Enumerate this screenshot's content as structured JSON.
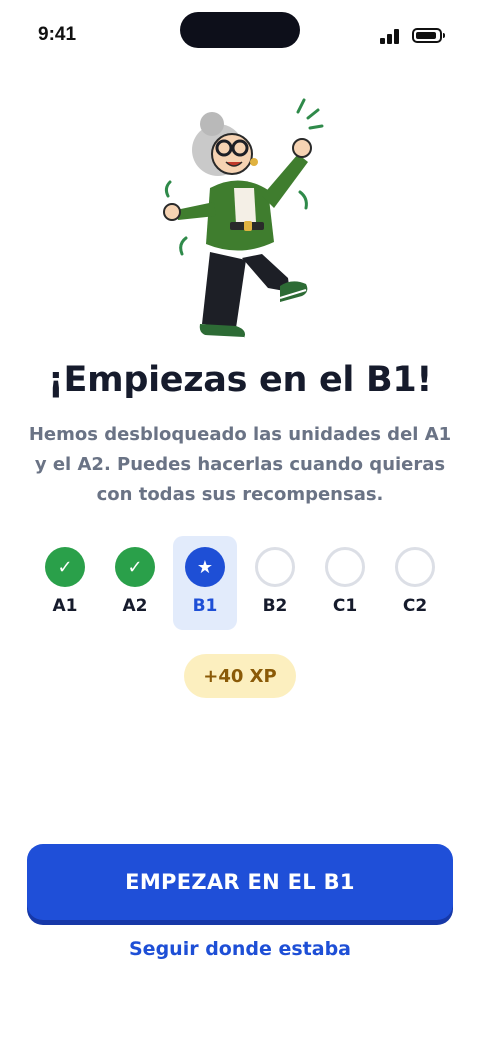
{
  "status_bar": {
    "time": "9:41"
  },
  "illustration": {
    "name": "dancing-grandma-illustration"
  },
  "title": "¡Empiezas en el B1!",
  "subtitle_lines": [
    "Hemos desbloqueado las unidades del A1",
    "y el A2. Puedes hacerlas cuando quieras",
    "con todas sus recompensas."
  ],
  "levels": [
    {
      "label": "A1",
      "state": "done",
      "glyph": "✓"
    },
    {
      "label": "A2",
      "state": "done",
      "glyph": "✓"
    },
    {
      "label": "B1",
      "state": "active",
      "glyph": "★"
    },
    {
      "label": "B2",
      "state": "locked",
      "glyph": ""
    },
    {
      "label": "C1",
      "state": "locked",
      "glyph": ""
    },
    {
      "label": "C2",
      "state": "locked",
      "glyph": ""
    }
  ],
  "xp_badge": "+40 XP",
  "primary_button": "EMPEZAR EN EL B1",
  "secondary_link": "Seguir donde estaba",
  "colors": {
    "primary": "#1f4fd8",
    "done": "#2aa04a",
    "xp_bg": "#fcefbf",
    "xp_text": "#8a5a07",
    "current_bg": "#e2ebfb"
  }
}
